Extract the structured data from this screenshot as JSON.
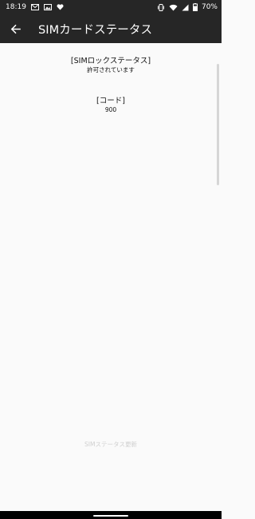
{
  "status_bar": {
    "time": "18:19",
    "battery": "70%",
    "left_icons": [
      "gmail-icon",
      "image-icon",
      "heart-icon"
    ],
    "right_icons": [
      "vibrate-icon",
      "wifi-icon",
      "signal-icon",
      "battery-icon"
    ]
  },
  "app_bar": {
    "title": "SIMカードステータス",
    "back_icon": "arrow-back-icon"
  },
  "sim_lock": {
    "label": "[SIMロックステータス]",
    "value": "許可されています"
  },
  "code": {
    "label": "[コード]",
    "value": "900"
  },
  "update_button": "SIMステータス更新",
  "colors": {
    "app_bar": "#262626",
    "background": "#fafafa",
    "disabled_text": "#cfcfcf"
  }
}
